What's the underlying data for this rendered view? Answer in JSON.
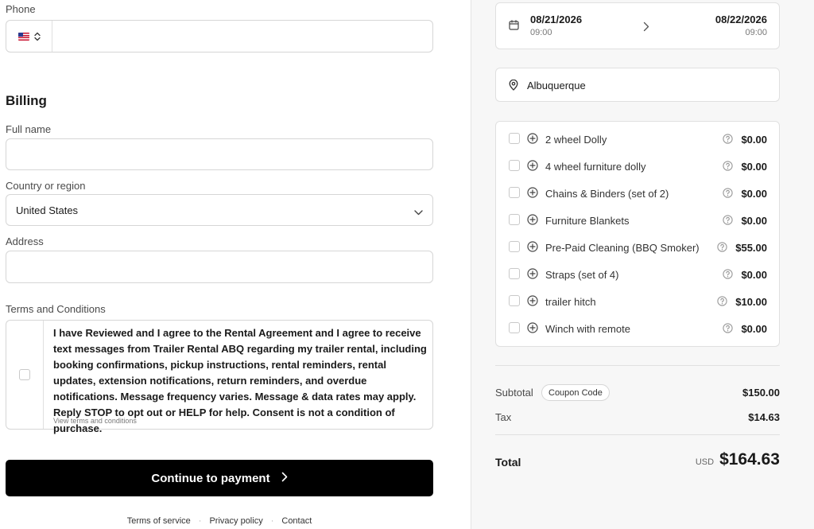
{
  "billing": {
    "phone_label": "Phone",
    "section_title": "Billing",
    "full_name_label": "Full name",
    "country_label": "Country or region",
    "country_value": "United States",
    "address_label": "Address",
    "terms_label": "Terms and Conditions",
    "terms_text": "I have Reviewed and I agree to the Rental Agreement and I agree to receive text messages from Trailer Rental ABQ regarding my trailer rental, including booking confirmations, pickup instructions, rental reminders, rental updates, extension notifications, return reminders, and overdue notifications. Message frequency varies. Message & data rates may apply. Reply STOP to opt out or HELP for help. Consent is not a condition of purchase.",
    "terms_link": "View terms and conditions",
    "continue_label": "Continue to payment"
  },
  "footer": {
    "links": [
      "Terms of service",
      "Privacy policy",
      "Contact"
    ],
    "separator": "·"
  },
  "booking": {
    "start_date": "08/21/2026",
    "start_time": "09:00",
    "end_date": "08/22/2026",
    "end_time": "09:00",
    "location": "Albuquerque"
  },
  "addons": [
    {
      "name": "2 wheel Dolly",
      "price": "$0.00"
    },
    {
      "name": "4 wheel furniture dolly",
      "price": "$0.00"
    },
    {
      "name": "Chains & Binders (set of 2)",
      "price": "$0.00"
    },
    {
      "name": "Furniture Blankets",
      "price": "$0.00"
    },
    {
      "name": "Pre-Paid Cleaning (BBQ Smoker)",
      "price": "$55.00"
    },
    {
      "name": "Straps (set of 4)",
      "price": "$0.00"
    },
    {
      "name": "trailer hitch",
      "price": "$10.00"
    },
    {
      "name": "Winch with remote",
      "price": "$0.00"
    }
  ],
  "summary": {
    "subtotal_label": "Subtotal",
    "coupon_label": "Coupon Code",
    "subtotal_value": "$150.00",
    "tax_label": "Tax",
    "tax_value": "$14.63",
    "total_label": "Total",
    "currency": "USD",
    "total_value": "$164.63"
  },
  "icons": {
    "flag": "us-flag-icon",
    "country_chevron": "chevron-down-icon",
    "date": "calendar-icon",
    "date_arrow": "chevron-right-icon",
    "location": "map-pin-icon",
    "addon": "plus-circle-icon",
    "help": "question-circle-icon"
  }
}
